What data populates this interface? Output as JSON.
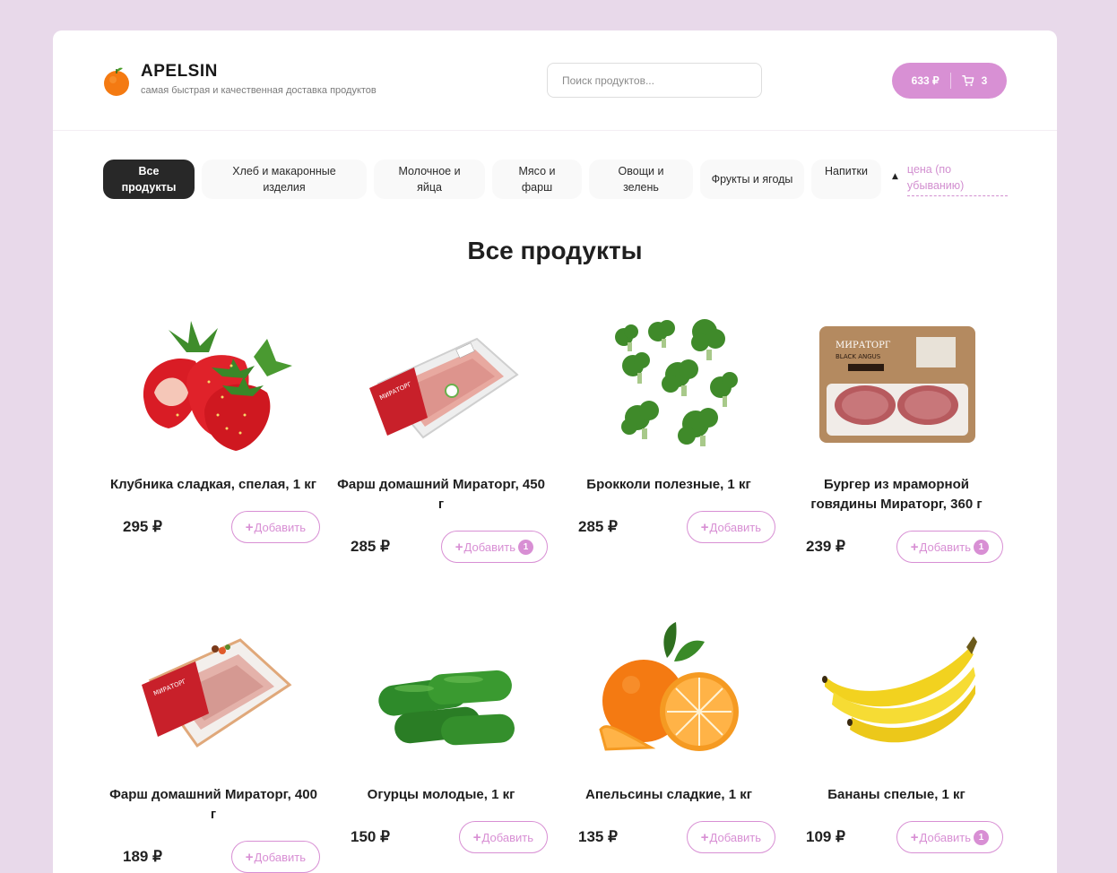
{
  "header": {
    "brand": "APELSIN",
    "tagline": "самая быстрая и качественная доставка продуктов",
    "search_placeholder": "Поиск продуктов...",
    "cart_total": "633 ₽",
    "cart_count": "3"
  },
  "categories": [
    "Все продукты",
    "Хлеб и макаронные изделия",
    "Молочное и яйца",
    "Мясо и фарш",
    "Овощи и зелень",
    "Фрукты и ягоды",
    "Напитки"
  ],
  "active_category": "Все продукты",
  "sort": {
    "label": "цена (по убыванию)",
    "arrow": "▲"
  },
  "page_title": "Все продукты",
  "add_label": "Добавить",
  "colors": {
    "accent": "#d890d4",
    "background": "#e8d9ea",
    "active_category": "#282828"
  },
  "products": [
    {
      "name": "Клубника сладкая, спелая, 1 кг",
      "price": "295 ₽",
      "in_cart": null,
      "image": "strawberry-image"
    },
    {
      "name": "Фарш домашний Мираторг, 450 г",
      "price": "285 ₽",
      "in_cart": "1",
      "image": "mince-package-image"
    },
    {
      "name": "Брокколи полезные, 1 кг",
      "price": "285 ₽",
      "in_cart": null,
      "image": "broccoli-image"
    },
    {
      "name": "Бургер из мраморной говядины Мираторг, 360 г",
      "price": "239 ₽",
      "in_cart": "1",
      "image": "burger-package-image"
    },
    {
      "name": "Фарш домашний Мираторг, 400 г",
      "price": "189 ₽",
      "in_cart": null,
      "image": "mince-package-image"
    },
    {
      "name": "Огурцы молодые, 1 кг",
      "price": "150 ₽",
      "in_cart": null,
      "image": "cucumber-image"
    },
    {
      "name": "Апельсины сладкие, 1 кг",
      "price": "135 ₽",
      "in_cart": null,
      "image": "orange-image"
    },
    {
      "name": "Бананы спелые, 1 кг",
      "price": "109 ₽",
      "in_cart": "1",
      "image": "banana-image"
    }
  ]
}
